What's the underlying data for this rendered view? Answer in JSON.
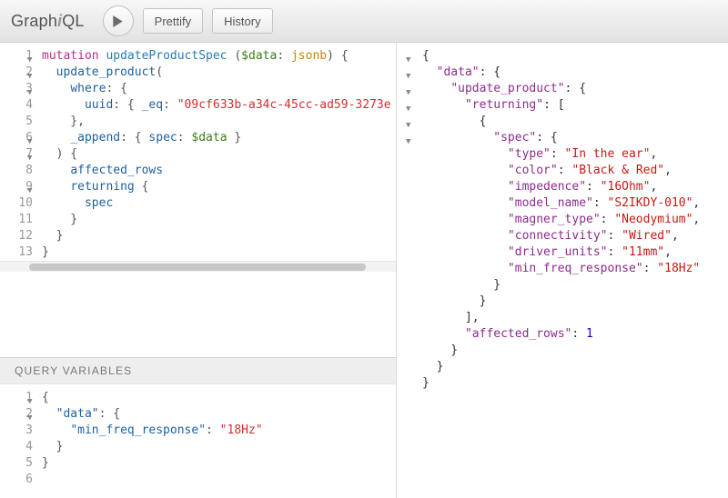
{
  "toolbar": {
    "logo_prefix": "Graph",
    "logo_accent": "i",
    "logo_suffix": "QL",
    "prettify_label": "Prettify",
    "history_label": "History"
  },
  "query_editor": {
    "lines": [
      "1",
      "2",
      "3",
      "4",
      "5",
      "6",
      "7",
      "8",
      "9",
      "10",
      "11",
      "12",
      "13"
    ],
    "folds": [
      1,
      2,
      3,
      6,
      7,
      9
    ],
    "tokens": [
      [
        [
          "kw",
          "mutation"
        ],
        [
          "punct",
          " "
        ],
        [
          "name",
          "updateProductSpec"
        ],
        [
          "punct",
          " ("
        ],
        [
          "var",
          "$data"
        ],
        [
          "punct",
          ": "
        ],
        [
          "type",
          "jsonb"
        ],
        [
          "punct",
          ") {"
        ]
      ],
      [
        [
          "punct",
          "  "
        ],
        [
          "attr",
          "update_product"
        ],
        [
          "punct",
          "("
        ]
      ],
      [
        [
          "punct",
          "    "
        ],
        [
          "attr",
          "where"
        ],
        [
          "punct",
          ": {"
        ]
      ],
      [
        [
          "punct",
          "      "
        ],
        [
          "attr",
          "uuid"
        ],
        [
          "punct",
          ": { "
        ],
        [
          "attr",
          "_eq"
        ],
        [
          "punct",
          ": "
        ],
        [
          "str",
          "\"09cf633b-a34c-45cc-ad59-3273e"
        ]
      ],
      [
        [
          "punct",
          "    },"
        ]
      ],
      [
        [
          "punct",
          "    "
        ],
        [
          "attr",
          "_append"
        ],
        [
          "punct",
          ": { "
        ],
        [
          "attr",
          "spec"
        ],
        [
          "punct",
          ": "
        ],
        [
          "var",
          "$data"
        ],
        [
          "punct",
          " }"
        ]
      ],
      [
        [
          "punct",
          "  ) {"
        ]
      ],
      [
        [
          "punct",
          "    "
        ],
        [
          "attr",
          "affected_rows"
        ]
      ],
      [
        [
          "punct",
          "    "
        ],
        [
          "attr",
          "returning"
        ],
        [
          "punct",
          " {"
        ]
      ],
      [
        [
          "punct",
          "      "
        ],
        [
          "attr",
          "spec"
        ]
      ],
      [
        [
          "punct",
          "    }"
        ]
      ],
      [
        [
          "punct",
          "  }"
        ]
      ],
      [
        [
          "punct",
          "}"
        ]
      ]
    ]
  },
  "vars_header": "QUERY VARIABLES",
  "vars_editor": {
    "lines": [
      "1",
      "2",
      "3",
      "4",
      "5",
      "6"
    ],
    "folds": [
      1,
      2
    ],
    "tokens": [
      [
        [
          "punct",
          "{"
        ]
      ],
      [
        [
          "punct",
          "  "
        ],
        [
          "prop",
          "\"data\""
        ],
        [
          "punct",
          ": {"
        ]
      ],
      [
        [
          "punct",
          "    "
        ],
        [
          "prop",
          "\"min_freq_response\""
        ],
        [
          "punct",
          ": "
        ],
        [
          "str",
          "\"18Hz\""
        ]
      ],
      [
        [
          "punct",
          "  }"
        ]
      ],
      [
        [
          "punct",
          "}"
        ]
      ],
      [
        [
          "punct",
          " "
        ]
      ]
    ]
  },
  "result": {
    "folds": [
      1,
      2,
      3,
      4,
      5,
      6
    ],
    "tokens": [
      [
        [
          "punct",
          "{"
        ]
      ],
      [
        [
          "punct",
          "  "
        ],
        [
          "key",
          "\"data\""
        ],
        [
          "punct",
          ": {"
        ]
      ],
      [
        [
          "punct",
          "    "
        ],
        [
          "key",
          "\"update_product\""
        ],
        [
          "punct",
          ": {"
        ]
      ],
      [
        [
          "punct",
          "      "
        ],
        [
          "key",
          "\"returning\""
        ],
        [
          "punct",
          ": ["
        ]
      ],
      [
        [
          "punct",
          "        {"
        ]
      ],
      [
        [
          "punct",
          "          "
        ],
        [
          "key",
          "\"spec\""
        ],
        [
          "punct",
          ": {"
        ]
      ],
      [
        [
          "punct",
          "            "
        ],
        [
          "key",
          "\"type\""
        ],
        [
          "punct",
          ": "
        ],
        [
          "str",
          "\"In the ear\""
        ],
        [
          "punct",
          ","
        ]
      ],
      [
        [
          "punct",
          "            "
        ],
        [
          "key",
          "\"color\""
        ],
        [
          "punct",
          ": "
        ],
        [
          "str",
          "\"Black & Red\""
        ],
        [
          "punct",
          ","
        ]
      ],
      [
        [
          "punct",
          "            "
        ],
        [
          "key",
          "\"impedence\""
        ],
        [
          "punct",
          ": "
        ],
        [
          "str",
          "\"16Ohm\""
        ],
        [
          "punct",
          ","
        ]
      ],
      [
        [
          "punct",
          "            "
        ],
        [
          "key",
          "\"model_name\""
        ],
        [
          "punct",
          ": "
        ],
        [
          "str",
          "\"S2IKDY-010\""
        ],
        [
          "punct",
          ","
        ]
      ],
      [
        [
          "punct",
          "            "
        ],
        [
          "key",
          "\"magner_type\""
        ],
        [
          "punct",
          ": "
        ],
        [
          "str",
          "\"Neodymium\""
        ],
        [
          "punct",
          ","
        ]
      ],
      [
        [
          "punct",
          "            "
        ],
        [
          "key",
          "\"connectivity\""
        ],
        [
          "punct",
          ": "
        ],
        [
          "str",
          "\"Wired\""
        ],
        [
          "punct",
          ","
        ]
      ],
      [
        [
          "punct",
          "            "
        ],
        [
          "key",
          "\"driver_units\""
        ],
        [
          "punct",
          ": "
        ],
        [
          "str",
          "\"11mm\""
        ],
        [
          "punct",
          ","
        ]
      ],
      [
        [
          "punct",
          "            "
        ],
        [
          "key",
          "\"min_freq_response\""
        ],
        [
          "punct",
          ": "
        ],
        [
          "str",
          "\"18Hz\""
        ]
      ],
      [
        [
          "punct",
          "          }"
        ]
      ],
      [
        [
          "punct",
          "        }"
        ]
      ],
      [
        [
          "punct",
          "      ],"
        ]
      ],
      [
        [
          "punct",
          "      "
        ],
        [
          "key",
          "\"affected_rows\""
        ],
        [
          "punct",
          ": "
        ],
        [
          "num",
          "1"
        ]
      ],
      [
        [
          "punct",
          "    }"
        ]
      ],
      [
        [
          "punct",
          "  }"
        ]
      ],
      [
        [
          "punct",
          "}"
        ]
      ]
    ]
  }
}
